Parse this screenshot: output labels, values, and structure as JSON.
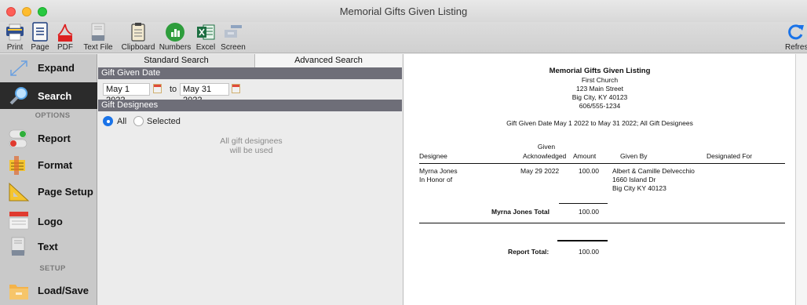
{
  "window": {
    "title": "Memorial Gifts Given Listing"
  },
  "toolbar": {
    "print": "Print",
    "page": "Page",
    "pdf": "PDF",
    "text_file": "Text File",
    "clipboard": "Clipboard",
    "numbers": "Numbers",
    "excel": "Excel",
    "screen": "Screen",
    "refresh": "Refres"
  },
  "sidebar": {
    "expand": "Expand",
    "search": "Search",
    "options_header": "OPTIONS",
    "report": "Report",
    "format": "Format",
    "page_setup": "Page Setup",
    "logo": "Logo",
    "text": "Text",
    "setup_header": "SETUP",
    "load_save": "Load/Save"
  },
  "search": {
    "tabs": {
      "standard": "Standard Search",
      "advanced": "Advanced Search"
    },
    "gift_given_date_header": "Gift Given Date",
    "date_from": "May 1 2022",
    "date_to_label": "to",
    "date_to": "May 31 2022",
    "gift_designees_header": "Gift Designees",
    "radio_all": "All",
    "radio_selected": "Selected",
    "hint_line1": "All gift designees",
    "hint_line2": "will be used"
  },
  "report": {
    "title": "Memorial Gifts Given Listing",
    "org_name": "First Church",
    "address1": "123 Main Street",
    "address2": "Big City, KY  40123",
    "phone": "606/555-1234",
    "criteria": "Gift Given Date May 1 2022 to May 31 2022; All Gift Designees",
    "columns": {
      "designee": "Designee",
      "given_line1": "Given",
      "acknowledged": "Acknowledged",
      "amount": "Amount",
      "given_by": "Given By",
      "designated_for": "Designated For"
    },
    "row": {
      "designee": "Myrna Jones",
      "designee_sub": "In Honor of",
      "date": "May 29 2022",
      "amount": "100.00",
      "given_by_1": "Albert & Camille Delvecchio",
      "given_by_2": "1660 Island Dr",
      "given_by_3": "Big City KY 40123"
    },
    "subtotal_label": "Myrna Jones Total",
    "subtotal_value": "100.00",
    "total_label": "Report Total:",
    "total_value": "100.00"
  },
  "colors": {
    "section_bar": "#6e6e78",
    "radio_accent": "#1a73e8",
    "sidebar_active": "#2b2b2b"
  }
}
